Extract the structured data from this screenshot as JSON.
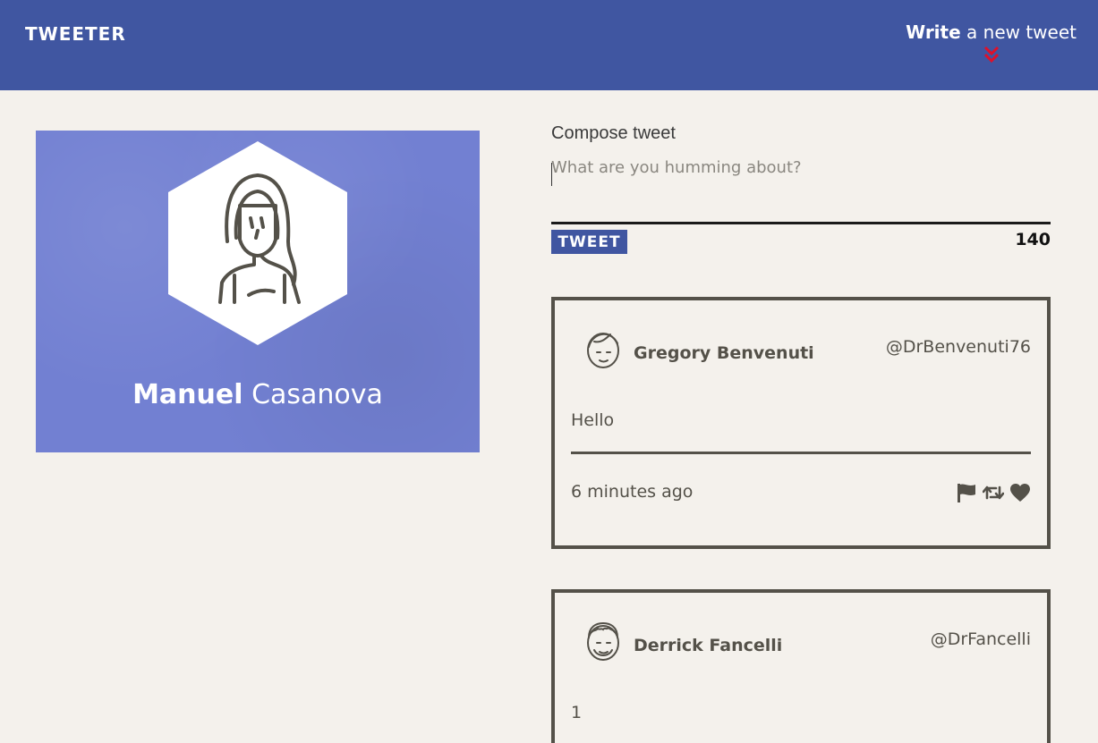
{
  "nav": {
    "logo": "TWEETER",
    "write_bold": "Write",
    "write_rest": " a new tweet"
  },
  "profile": {
    "first_name": "Manuel",
    "last_name": " Casanova"
  },
  "compose": {
    "title": "Compose tweet",
    "placeholder": "What are you humming about?",
    "button": "TWEET",
    "counter": "140"
  },
  "tweets": [
    {
      "name": "Gregory Benvenuti",
      "handle": "@DrBenvenuti76",
      "content": "Hello",
      "time": "6 minutes ago"
    },
    {
      "name": "Derrick Fancelli",
      "handle": "@DrFancelli",
      "content": "1"
    }
  ],
  "colors": {
    "nav_bg": "#4056a1",
    "accent_red": "#e0102a",
    "page_bg": "#f4f1ec",
    "text": "#545149"
  },
  "icons": [
    "chevron-double-down-icon",
    "flag-icon",
    "retweet-icon",
    "heart-icon"
  ]
}
